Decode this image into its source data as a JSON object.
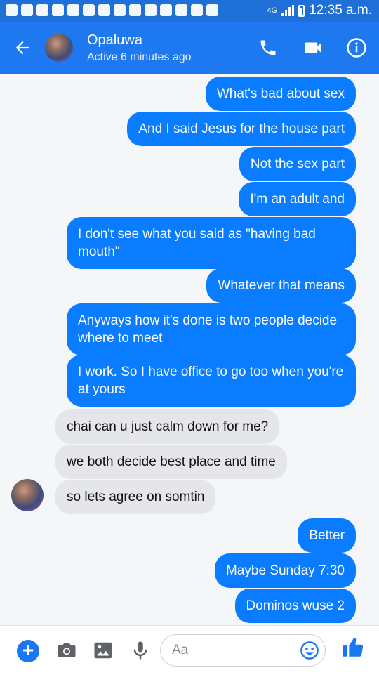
{
  "status_bar": {
    "network": "4G",
    "time": "12:35 a.m."
  },
  "header": {
    "name": "Opaluwa",
    "active_status": "Active 6 minutes ago"
  },
  "messages": [
    {
      "from": "me",
      "text": "What's bad about sex"
    },
    {
      "from": "me",
      "text": "And I said Jesus for the house part"
    },
    {
      "from": "me",
      "text": "Not the sex part"
    },
    {
      "from": "me",
      "text": "I'm an adult and"
    },
    {
      "from": "me",
      "text": "I don't see what you said as \"having bad mouth\""
    },
    {
      "from": "me",
      "text": "Whatever that means"
    },
    {
      "from": "me",
      "text": "Anyways how it's done is two people decide where to meet"
    },
    {
      "from": "me",
      "text": "I work. So I have office to go too when you're at yours"
    },
    {
      "from": "them",
      "text": "chai can u just calm down for me?"
    },
    {
      "from": "them",
      "text": "we both decide best place and time"
    },
    {
      "from": "them",
      "text": "so lets agree on somtin"
    },
    {
      "from": "me",
      "text": "Better"
    },
    {
      "from": "me",
      "text": "Maybe Sunday 7:30"
    },
    {
      "from": "me",
      "text": "Dominos wuse 2"
    }
  ],
  "composer": {
    "placeholder": "Aa"
  },
  "colors": {
    "header": "#1e78ef",
    "status_bar": "#1e6fd8",
    "outgoing_bubble": "#0a7cff",
    "incoming_bubble": "#e4e6eb",
    "accent": "#1877f2"
  }
}
